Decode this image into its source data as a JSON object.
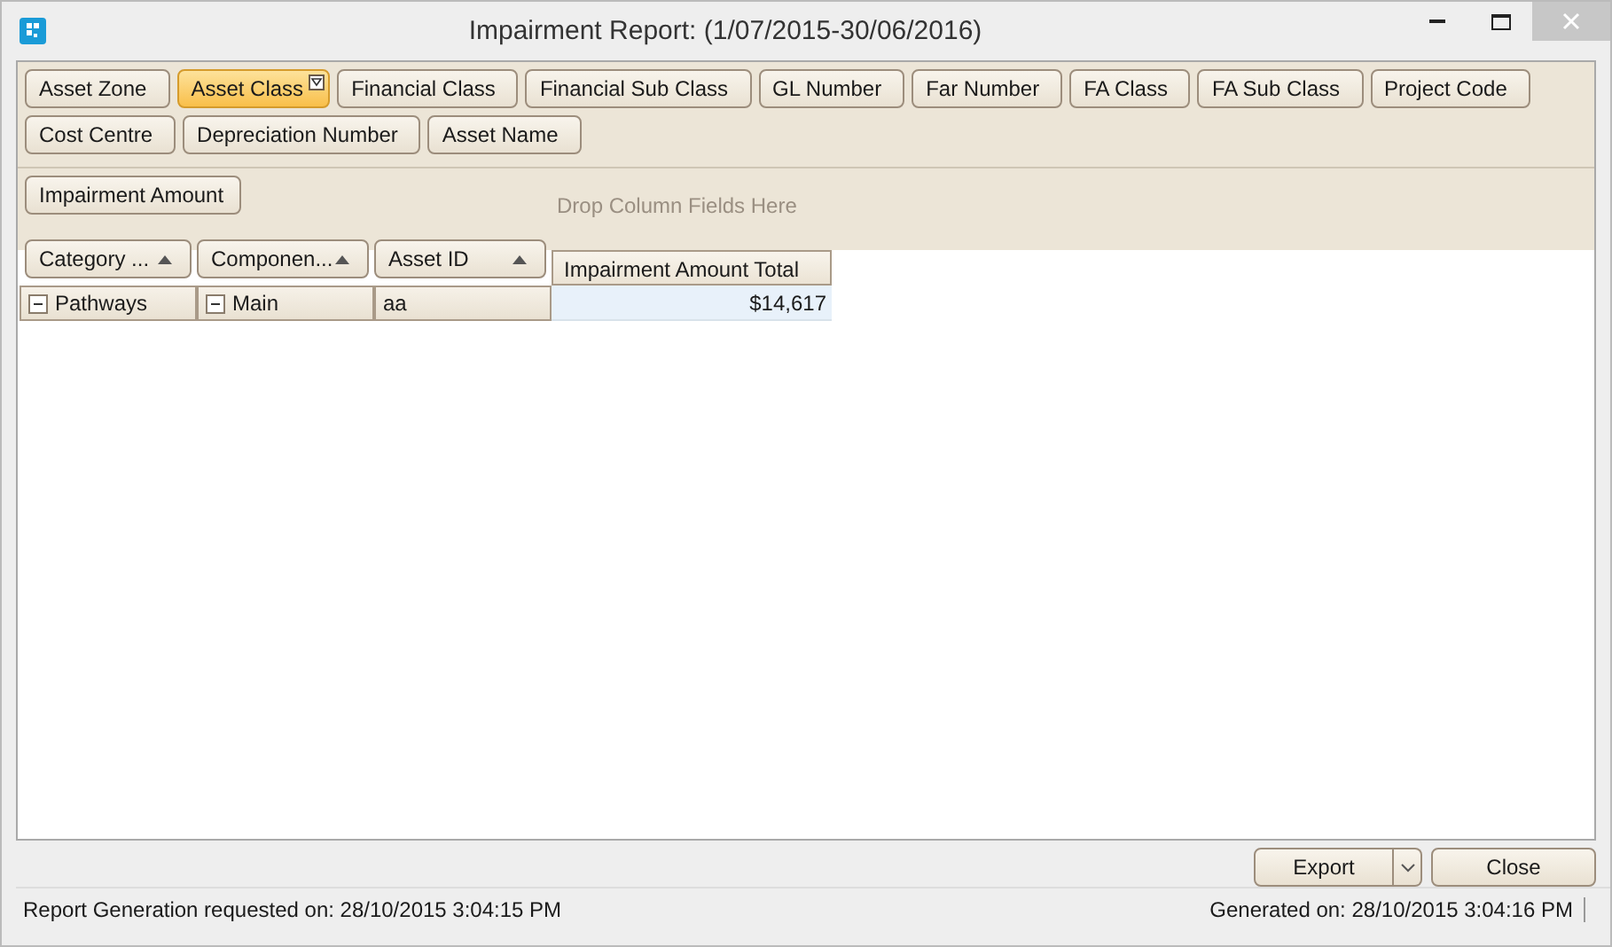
{
  "window": {
    "title": "Impairment Report: (1/07/2015-30/06/2016)"
  },
  "filter_fields": [
    {
      "label": "Asset Zone",
      "selected": false,
      "filtered": false
    },
    {
      "label": "Asset Class",
      "selected": true,
      "filtered": true
    },
    {
      "label": "Financial Class",
      "selected": false,
      "filtered": false
    },
    {
      "label": "Financial Sub Class",
      "selected": false,
      "filtered": false
    },
    {
      "label": "GL Number",
      "selected": false,
      "filtered": false
    },
    {
      "label": "Far Number",
      "selected": false,
      "filtered": false
    },
    {
      "label": "FA Class",
      "selected": false,
      "filtered": false
    },
    {
      "label": "FA Sub Class",
      "selected": false,
      "filtered": false
    },
    {
      "label": "Project Code",
      "selected": false,
      "filtered": false
    },
    {
      "label": "Cost Centre",
      "selected": false,
      "filtered": false
    },
    {
      "label": "Depreciation Number",
      "selected": false,
      "filtered": false
    },
    {
      "label": "Asset Name",
      "selected": false,
      "filtered": false
    }
  ],
  "data_fields": [
    {
      "label": "Impairment Amount"
    }
  ],
  "column_area": {
    "hint": "Drop Column Fields Here"
  },
  "row_fields": [
    {
      "label": "Category ..."
    },
    {
      "label": "Componen..."
    },
    {
      "label": "Asset ID"
    }
  ],
  "column_header": "Impairment Amount Total",
  "rows": [
    {
      "cells": [
        {
          "text": "Pathways",
          "expanded": true
        },
        {
          "text": "Main",
          "expanded": true
        },
        {
          "text": "aa"
        }
      ],
      "value": "$14,617"
    }
  ],
  "buttons": {
    "export": "Export",
    "close": "Close"
  },
  "status_bar": {
    "left": "Report Generation requested on: 28/10/2015 3:04:15 PM",
    "right": "Generated on: 28/10/2015 3:04:16 PM"
  }
}
